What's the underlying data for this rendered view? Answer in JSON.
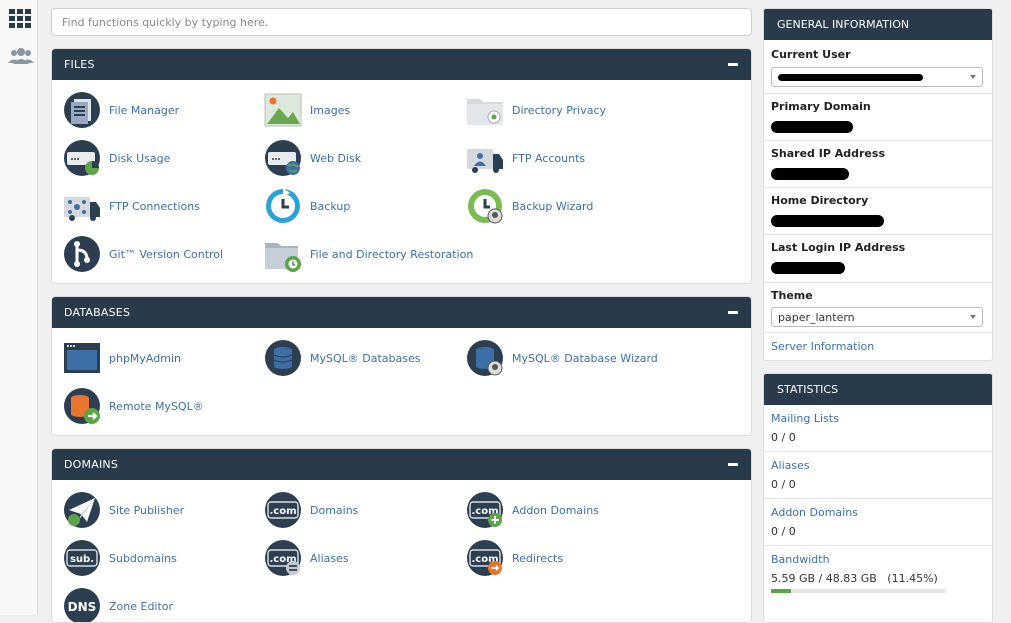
{
  "search": {
    "placeholder": "Find functions quickly by typing here."
  },
  "rail": {
    "apps_icon": "grid-icon",
    "users_icon": "users-icon"
  },
  "files": {
    "title": "FILES",
    "items": [
      {
        "label": "File Manager",
        "icon": "file-manager-icon"
      },
      {
        "label": "Images",
        "icon": "images-icon"
      },
      {
        "label": "Directory Privacy",
        "icon": "directory-privacy-icon"
      },
      {
        "label": "Disk Usage",
        "icon": "disk-usage-icon"
      },
      {
        "label": "Web Disk",
        "icon": "web-disk-icon"
      },
      {
        "label": "FTP Accounts",
        "icon": "ftp-accounts-icon"
      },
      {
        "label": "FTP Connections",
        "icon": "ftp-connections-icon"
      },
      {
        "label": "Backup",
        "icon": "backup-icon"
      },
      {
        "label": "Backup Wizard",
        "icon": "backup-wizard-icon"
      },
      {
        "label": "Git™ Version Control",
        "icon": "git-icon"
      },
      {
        "label": "File and Directory Restoration",
        "icon": "restore-icon"
      }
    ]
  },
  "databases": {
    "title": "DATABASES",
    "items": [
      {
        "label": "phpMyAdmin",
        "icon": "phpmyadmin-icon"
      },
      {
        "label": "MySQL® Databases",
        "icon": "mysql-databases-icon"
      },
      {
        "label": "MySQL® Database Wizard",
        "icon": "mysql-wizard-icon"
      },
      {
        "label": "Remote MySQL®",
        "icon": "remote-mysql-icon"
      }
    ]
  },
  "domains": {
    "title": "DOMAINS",
    "items": [
      {
        "label": "Site Publisher",
        "icon": "site-publisher-icon"
      },
      {
        "label": "Domains",
        "icon": "domains-icon",
        "text": ".com"
      },
      {
        "label": "Addon Domains",
        "icon": "addon-domains-icon",
        "text": ".com"
      },
      {
        "label": "Subdomains",
        "icon": "subdomains-icon",
        "text": "sub."
      },
      {
        "label": "Aliases",
        "icon": "aliases-icon",
        "text": ".com"
      },
      {
        "label": "Redirects",
        "icon": "redirects-icon",
        "text": ".com"
      },
      {
        "label": "Zone Editor",
        "icon": "zone-editor-icon",
        "text": "DNS"
      }
    ]
  },
  "general": {
    "title": "GENERAL INFORMATION",
    "current_user_label": "Current User",
    "primary_domain_label": "Primary Domain",
    "shared_ip_label": "Shared IP Address",
    "home_dir_label": "Home Directory",
    "last_login_label": "Last Login IP Address",
    "theme_label": "Theme",
    "theme_value": "paper_lantern",
    "server_info_link": "Server Information"
  },
  "stats": {
    "title": "STATISTICS",
    "rows": [
      {
        "label": "Mailing Lists",
        "value": "0 / 0"
      },
      {
        "label": "Aliases",
        "value": "0 / 0"
      },
      {
        "label": "Addon Domains",
        "value": "0 / 0"
      },
      {
        "label": "Bandwidth",
        "value": "5.59 GB / 48.83 GB   (11.45%)",
        "fraction": 0.1145
      }
    ]
  },
  "colors": {
    "header": "#293a4a",
    "link": "#3d6fa6",
    "accent": "#5ca34a"
  }
}
